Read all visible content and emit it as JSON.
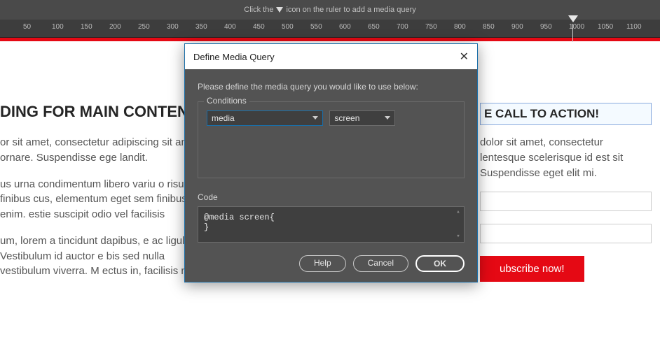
{
  "hint": {
    "before": "Click the",
    "after": "icon on the ruler to add a media query"
  },
  "ruler_ticks": [
    50,
    100,
    150,
    200,
    250,
    300,
    350,
    400,
    450,
    500,
    550,
    600,
    650,
    700,
    750,
    800,
    850,
    900,
    950,
    1000,
    1050,
    1100
  ],
  "page": {
    "heading_left": "DING FOR MAIN CONTENT",
    "p1": "or sit amet, consectetur adipiscing sit amet ornare. Suspendisse ege landit.",
    "p2": "us urna condimentum libero variu o risus finibus cus, elementum eget sem finibus sim enim. estie suscipit odio vel facilisis",
    "p3": "um, lorem a tincidunt dapibus, e ac ligula. Vestibulum id auctor e bis sed nulla vestibulum viverra. M ectus in, facilisis nisl.",
    "heading_right": "E CALL TO ACTION!",
    "pr": "dolor sit amet, consectetur lentesque scelerisque id est sit Suspendisse eget elit mi.",
    "subscribe": "ubscribe now!"
  },
  "modal": {
    "title": "Define Media Query",
    "intro": "Please define the media query you would like to use below:",
    "conditions_label": "Conditions",
    "select1": "media",
    "select2": "screen",
    "code_label": "Code",
    "code_text": "@media screen{\n}",
    "help": "Help",
    "cancel": "Cancel",
    "ok": "OK"
  }
}
